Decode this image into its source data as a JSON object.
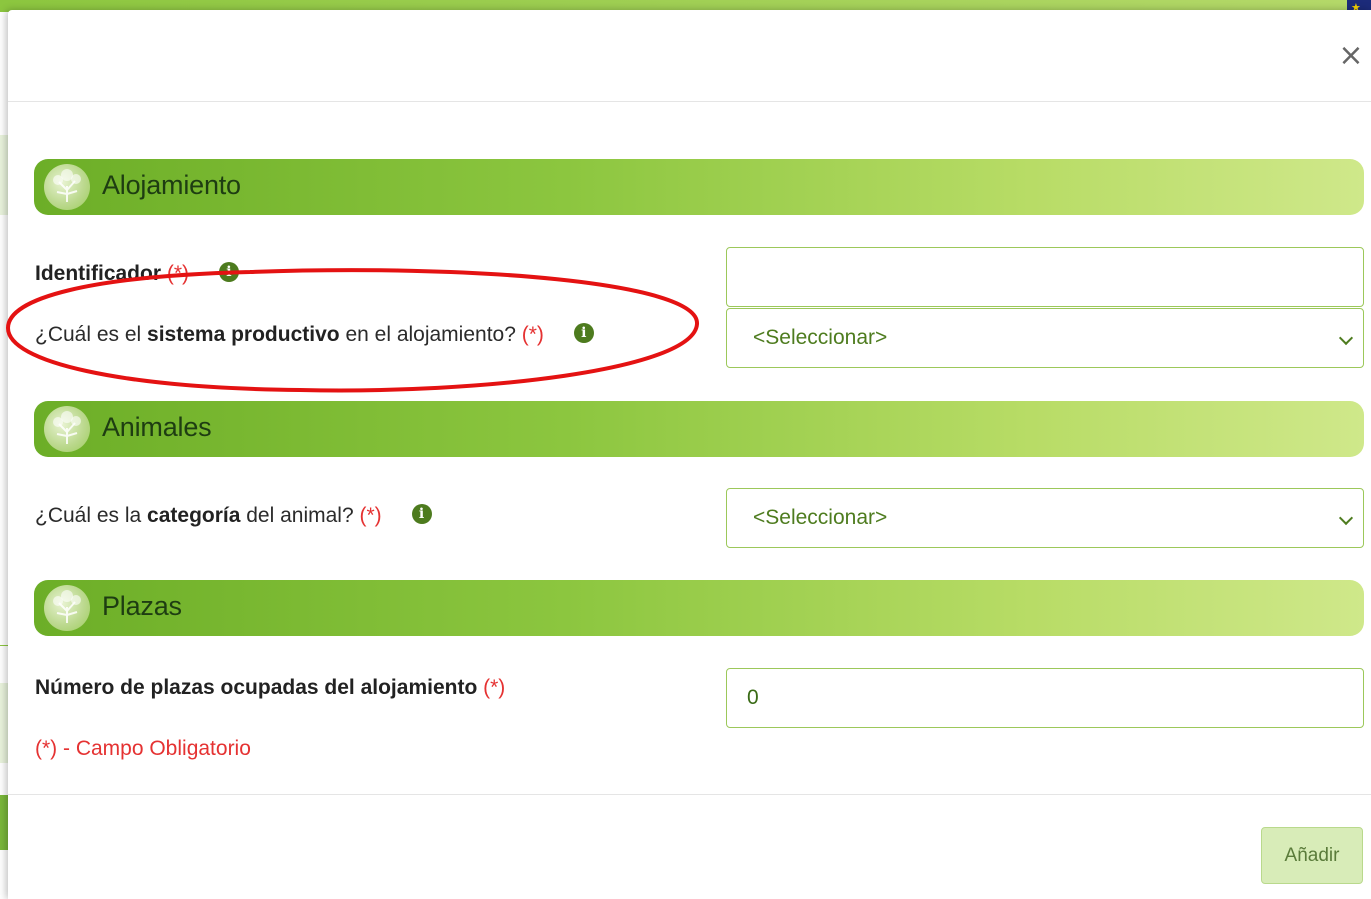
{
  "modal": {
    "close_label": "×",
    "sections": {
      "alojamiento": {
        "title": "Alojamiento",
        "identificador_label": "Identificador",
        "identificador_required": "(*)",
        "identificador_value": "",
        "sistema_q_before": "¿Cuál es el ",
        "sistema_q_bold": "sistema productivo",
        "sistema_q_after": " en el alojamiento? ",
        "sistema_required": "(*)",
        "sistema_selected": "<Seleccionar>"
      },
      "animales": {
        "title": "Animales",
        "categoria_q_before": "¿Cuál es la ",
        "categoria_q_bold": "categoría",
        "categoria_q_after": " del animal? ",
        "categoria_required": "(*)",
        "categoria_selected": "<Seleccionar>"
      },
      "plazas": {
        "title": "Plazas",
        "numero_label": "Número de plazas ocupadas del alojamiento",
        "numero_required": "(*)",
        "numero_value": "0"
      }
    },
    "required_note": "(*) - Campo Obligatorio",
    "add_button": "Añadir"
  },
  "info_icon_glyph": "i",
  "colors": {
    "brand_green": "#8cc63f",
    "required_red": "#e53232",
    "annotation_red": "#e41212"
  }
}
